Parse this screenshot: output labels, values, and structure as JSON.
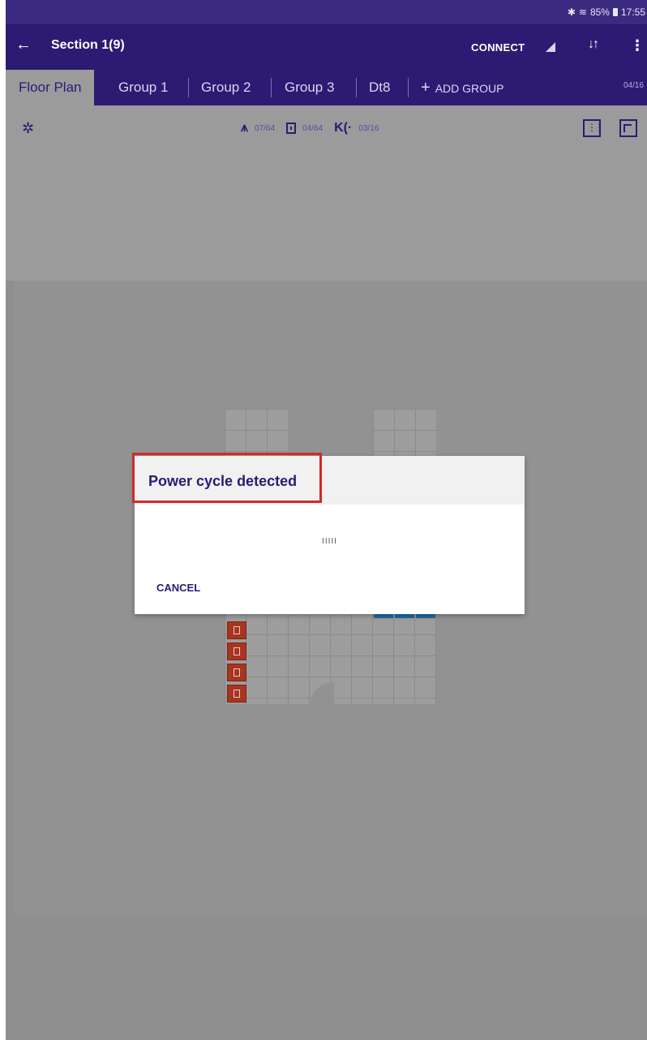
{
  "status_bar": {
    "battery": "85%",
    "time": "17:55"
  },
  "app_bar": {
    "title": "Section 1(9)",
    "connect_label": "CONNECT"
  },
  "tabs": [
    {
      "label": "Floor Plan"
    },
    {
      "label": "Group 1"
    },
    {
      "label": "Group 2"
    },
    {
      "label": "Group 3"
    },
    {
      "label": "Dt8"
    }
  ],
  "add_group_label": "ADD GROUP",
  "page_count": "04/16",
  "toolbar": {
    "lights_count": "07/64",
    "switches_count": "04/64",
    "sensors_count": "03/16"
  },
  "dialog": {
    "title": "Power cycle detected",
    "progress_text": "IIIII",
    "cancel_label": "CANCEL"
  },
  "colors": {
    "primary": "#2d1a73",
    "fixture": "#a83422",
    "highlight": "#d32a2a"
  },
  "icons": [
    "back-arrow-icon",
    "signal-icon",
    "sort-icon",
    "more-vert-icon",
    "gear-icon",
    "light-icon",
    "switch-icon",
    "sensor-icon",
    "grid-select-icon",
    "edit-icon"
  ]
}
